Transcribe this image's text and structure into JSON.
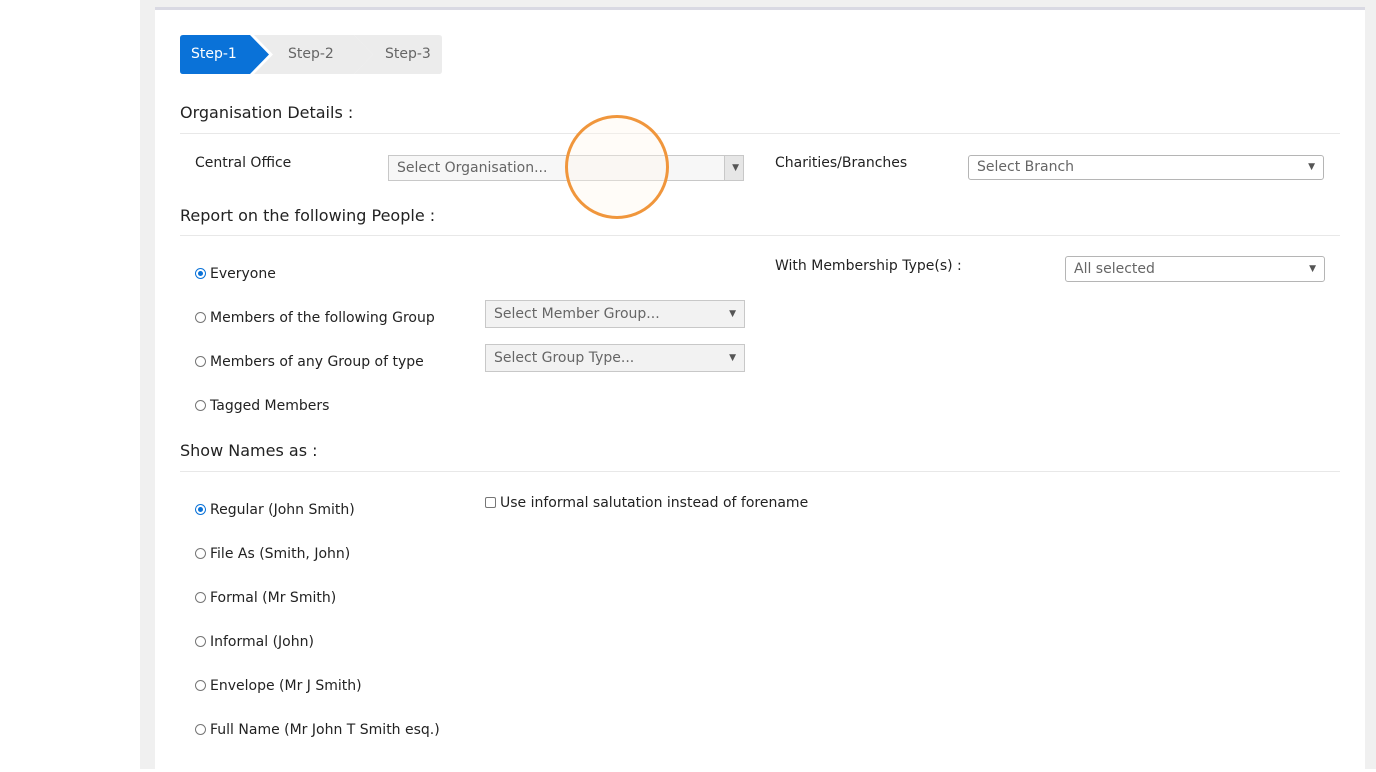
{
  "steps": [
    "Step-1",
    "Step-2",
    "Step-3"
  ],
  "active_step": 0,
  "colors": {
    "accent": "#0a72d8",
    "step_inactive": "#ececec",
    "cursor_ring": "#f0963c"
  },
  "organisation": {
    "title": "Organisation Details :",
    "central_office_label": "Central Office",
    "central_office_placeholder": "Select Organisation...",
    "branches_label": "Charities/Branches",
    "branches_placeholder": "Select Branch"
  },
  "people": {
    "title": "Report on the following People :",
    "options": [
      {
        "label": "Everyone",
        "checked": true
      },
      {
        "label": "Members of the following Group",
        "checked": false
      },
      {
        "label": "Members of any Group of type",
        "checked": false
      },
      {
        "label": "Tagged Members",
        "checked": false
      }
    ],
    "member_group_placeholder": "Select Member Group...",
    "group_type_placeholder": "Select Group Type...",
    "membership_label": "With Membership Type(s) :",
    "membership_value": "All selected"
  },
  "names": {
    "title": "Show Names as :",
    "options": [
      {
        "label": "Regular (John Smith)",
        "checked": true
      },
      {
        "label": "File As (Smith, John)",
        "checked": false
      },
      {
        "label": "Formal (Mr Smith)",
        "checked": false
      },
      {
        "label": "Informal (John)",
        "checked": false
      },
      {
        "label": "Envelope (Mr J Smith)",
        "checked": false
      },
      {
        "label": "Full Name (Mr John T Smith esq.)",
        "checked": false
      }
    ],
    "informal_checkbox_label": "Use informal salutation instead of forename",
    "informal_checked": false
  },
  "icons": {
    "dropdown": "chevron-down-icon",
    "cursor": "click-highlight-icon"
  }
}
